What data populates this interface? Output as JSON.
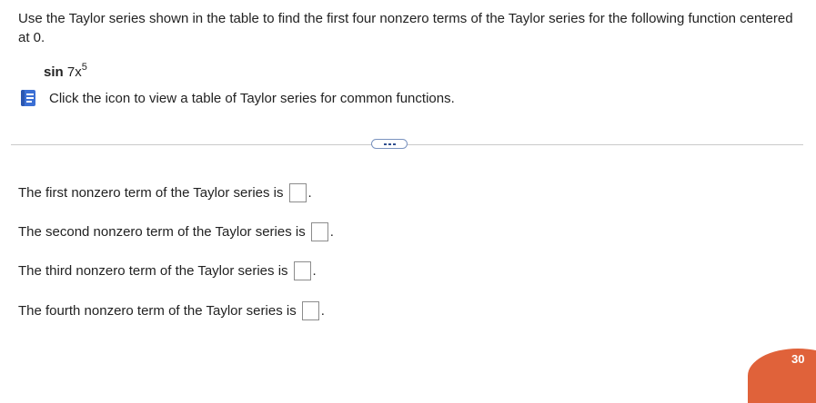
{
  "question": {
    "text": "Use the Taylor series shown in the table to find the first four nonzero terms of the Taylor series for the following function centered at 0.",
    "function_name": "sin",
    "function_base": "7x",
    "function_exponent": "5"
  },
  "table_link": {
    "icon": "book-icon",
    "text": "Click the icon to view a table of Taylor series for common functions."
  },
  "divider": {
    "button_icon": "ellipsis-icon"
  },
  "terms": [
    {
      "label": "The first nonzero term of the Taylor series is",
      "value": "",
      "suffix": "."
    },
    {
      "label": "The second nonzero term of the Taylor series is",
      "value": "",
      "suffix": "."
    },
    {
      "label": "The third nonzero term of the Taylor series is",
      "value": "",
      "suffix": "."
    },
    {
      "label": "The fourth nonzero term of the Taylor series is",
      "value": "",
      "suffix": "."
    }
  ],
  "badge": {
    "value": "30"
  },
  "colors": {
    "book_icon": "#3b6fd4",
    "badge": "#e0623a",
    "divider_button": "#2f4f8f"
  }
}
